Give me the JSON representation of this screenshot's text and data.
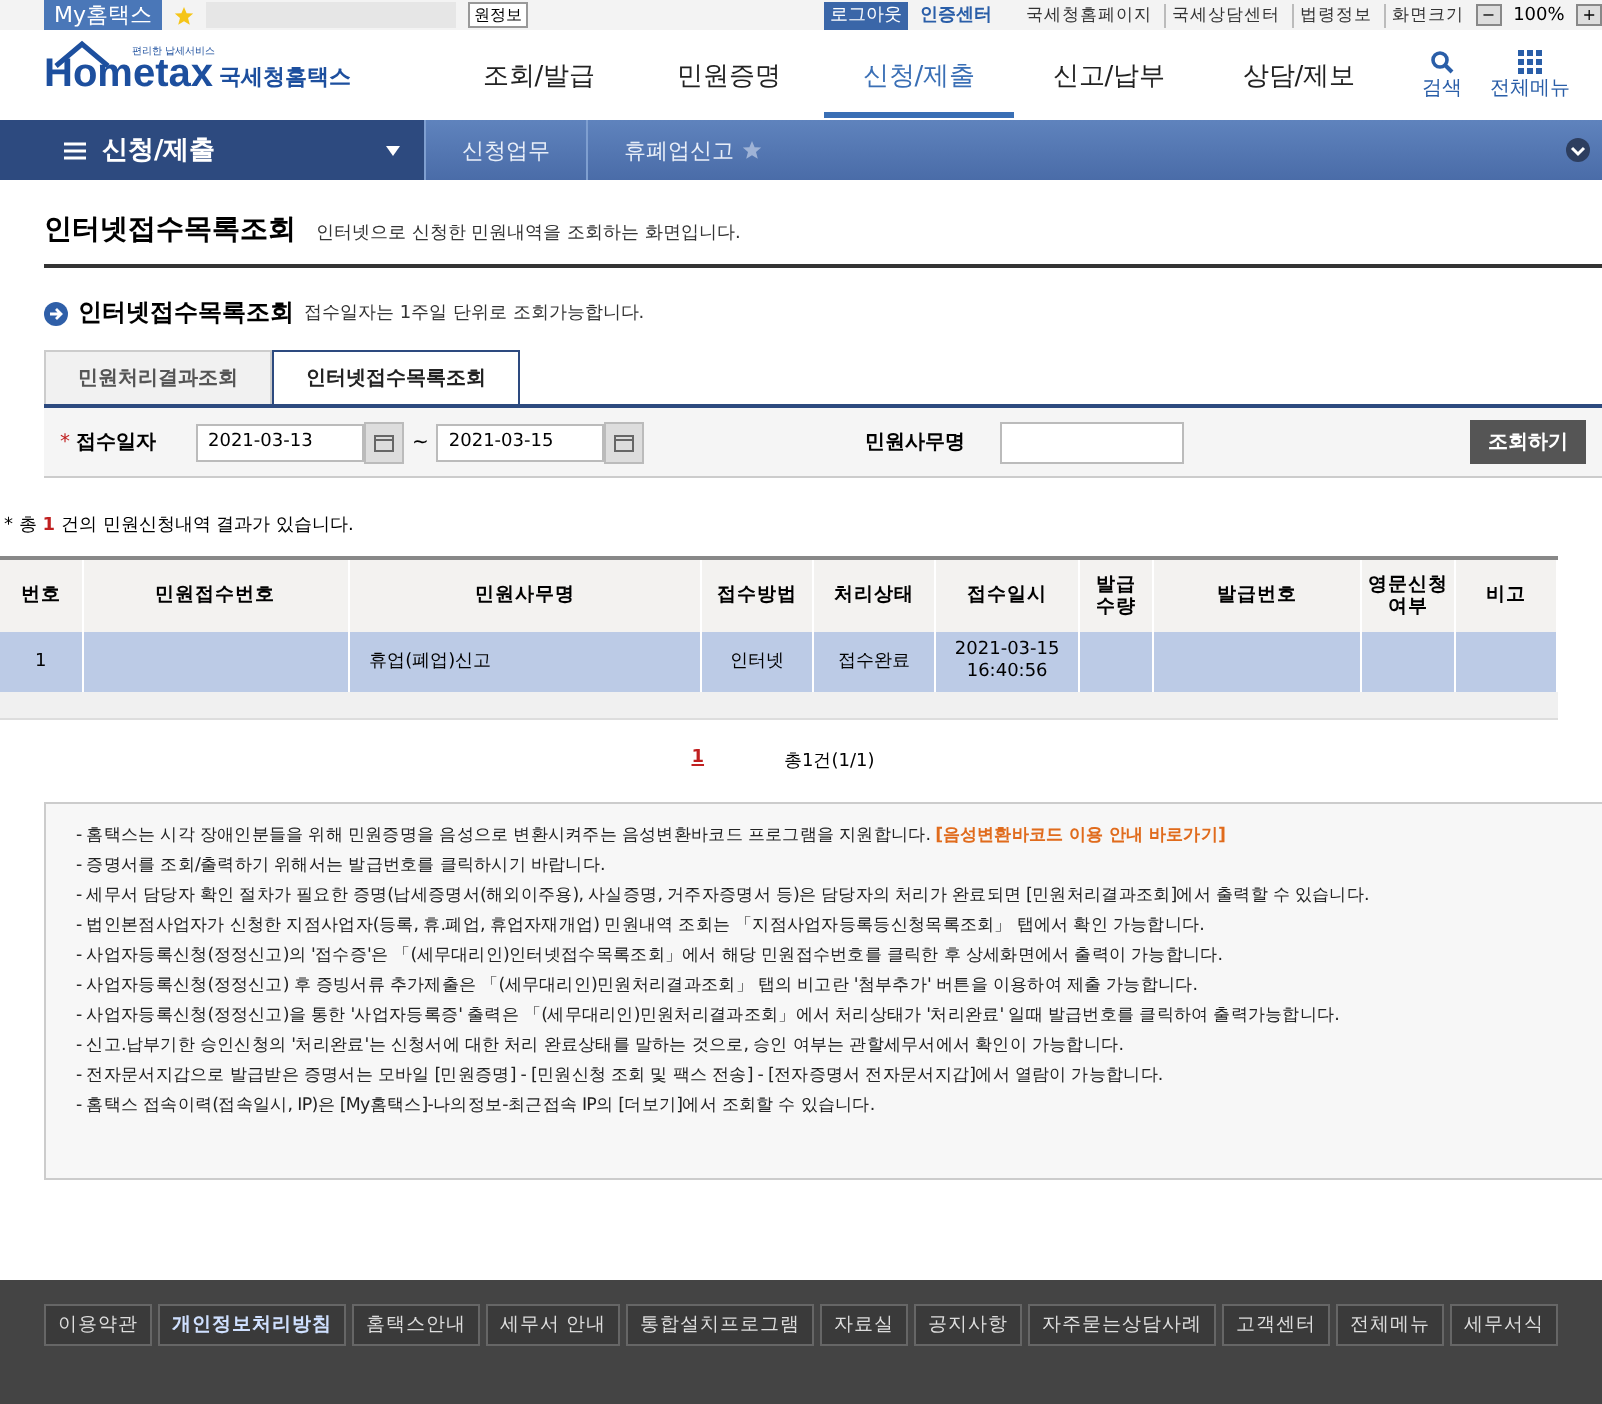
{
  "top_bar": {
    "my_label": "My홈택스",
    "partial_button": "원정보",
    "login_button": "로그아웃",
    "cert_link": "인증센터",
    "links": [
      "국세청홈페이지",
      "국세상담센터",
      "법령정보"
    ],
    "zoom_label": "화면크기",
    "zoom_value": "100%",
    "zoom_minus": "−",
    "zoom_plus": "+"
  },
  "header": {
    "logo_small": "편리한 납세서비스",
    "logo_text": "Hometax",
    "logo_kr": "국세청홈택스",
    "nav": [
      {
        "label": "조회/발급",
        "selected": false
      },
      {
        "label": "민원증명",
        "selected": false
      },
      {
        "label": "신청/제출",
        "selected": true
      },
      {
        "label": "신고/납부",
        "selected": false
      },
      {
        "label": "상담/제보",
        "selected": false
      }
    ],
    "search_label": "검색",
    "menu_label": "전체메뉴"
  },
  "breadcrumb": {
    "menu": "신청/제출",
    "items": [
      "신청업무",
      "휴폐업신고"
    ]
  },
  "page": {
    "title": "인터넷접수목록조회",
    "subtitle": "인터넷으로 신청한 민원내역을 조회하는 화면입니다."
  },
  "section": {
    "title": "인터넷접수목록조회",
    "note": "접수일자는 1주일 단위로 조회가능합니다."
  },
  "tabs": [
    {
      "label": "민원처리결과조회",
      "selected": false
    },
    {
      "label": "인터넷접수목록조회",
      "selected": true
    }
  ],
  "search": {
    "date_label": "접수일자",
    "required_mark": "*",
    "from": "2021-03-13",
    "tilde": "~",
    "to": "2021-03-15",
    "name_label": "민원사무명",
    "button": "조회하기"
  },
  "result_count": {
    "prefix": "* 총",
    "count": "1",
    "suffix": "건의 민원신청내역 결과가 있습니다."
  },
  "table": {
    "columns": [
      "번호",
      "민원접수번호",
      "민원사무명",
      "접수방법",
      "처리상태",
      "접수일시",
      "발급\n수량",
      "발급번호",
      "영문신청\n여부",
      "비고"
    ],
    "rows": [
      {
        "selected": true,
        "cells": [
          "1",
          "",
          "휴업(폐업)신고",
          "인터넷",
          "접수완료",
          "2021-03-15\n16:40:56",
          "",
          "",
          "",
          ""
        ]
      }
    ]
  },
  "pagination": {
    "pages": [
      {
        "label": "1",
        "selected": true
      }
    ],
    "total": "총1건(1/1)"
  },
  "notes": [
    {
      "text": "- 홈택스는 시각 장애인분들을 위해 민원증명을 음성으로 변환시켜주는 음성변환바코드 프로그램을 지원합니다.",
      "link": "[음성변환바코드 이용 안내 바로가기]"
    },
    {
      "text": "- 증명서를 조회/출력하기 위해서는 발급번호를 클릭하시기 바랍니다."
    },
    {
      "text": "- 세무서 담당자 확인 절차가 필요한 증명(납세증명서(해외이주용), 사실증명, 거주자증명서 등)은 담당자의 처리가 완료되면 [민원처리결과조회]에서 출력할 수 있습니다."
    },
    {
      "text": "- 법인본점사업자가 신청한 지점사업자(등록, 휴.폐업, 휴업자재개업) 민원내역 조회는 「지점사업자등록등신청목록조회」 탭에서 확인 가능합니다."
    },
    {
      "text": "- 사업자등록신청(정정신고)의 '접수증'은 「(세무대리인)인터넷접수목록조회」에서 해당 민원접수번호를 클릭한 후 상세화면에서 출력이 가능합니다."
    },
    {
      "text": "- 사업자등록신청(정정신고) 후 증빙서류 추가제출은 「(세무대리인)민원처리결과조회」 탭의 비고란 '첨부추가' 버튼을 이용하여 제출 가능합니다."
    },
    {
      "text": "- 사업자등록신청(정정신고)을 통한 '사업자등록증' 출력은 「(세무대리인)민원처리결과조회」에서 처리상태가 '처리완료' 일때 발급번호를 클릭하여 출력가능합니다."
    },
    {
      "text": "- 신고.납부기한 승인신청의 '처리완료'는 신청서에 대한 처리 완료상태를 말하는 것으로, 승인 여부는 관할세무서에서 확인이 가능합니다."
    },
    {
      "text": "- 전자문서지갑으로 발급받은 증명서는 모바일 [민원증명] - [민원신청 조회 및 팩스 전송] - [전자증명서 전자문서지갑]에서 열람이 가능합니다."
    },
    {
      "text": "- 홈택스 접속이력(접속일시, IP)은 [My홈택스]-나의정보-최근접속 IP의 [더보기]에서 조회할 수 있습니다."
    }
  ],
  "footer": {
    "links": [
      {
        "label": "이용약관",
        "bold": false
      },
      {
        "label": "개인정보처리방침",
        "bold": true
      },
      {
        "label": "홈택스안내",
        "bold": false
      },
      {
        "label": "세무서 안내",
        "bold": false
      },
      {
        "label": "통합설치프로그램",
        "bold": false
      },
      {
        "label": "자료실",
        "bold": false
      },
      {
        "label": "공지사항",
        "bold": false
      },
      {
        "label": "자주묻는상담사례",
        "bold": false
      },
      {
        "label": "고객센터",
        "bold": false
      },
      {
        "label": "전체메뉴",
        "bold": false
      },
      {
        "label": "세무서식",
        "bold": false
      }
    ]
  }
}
